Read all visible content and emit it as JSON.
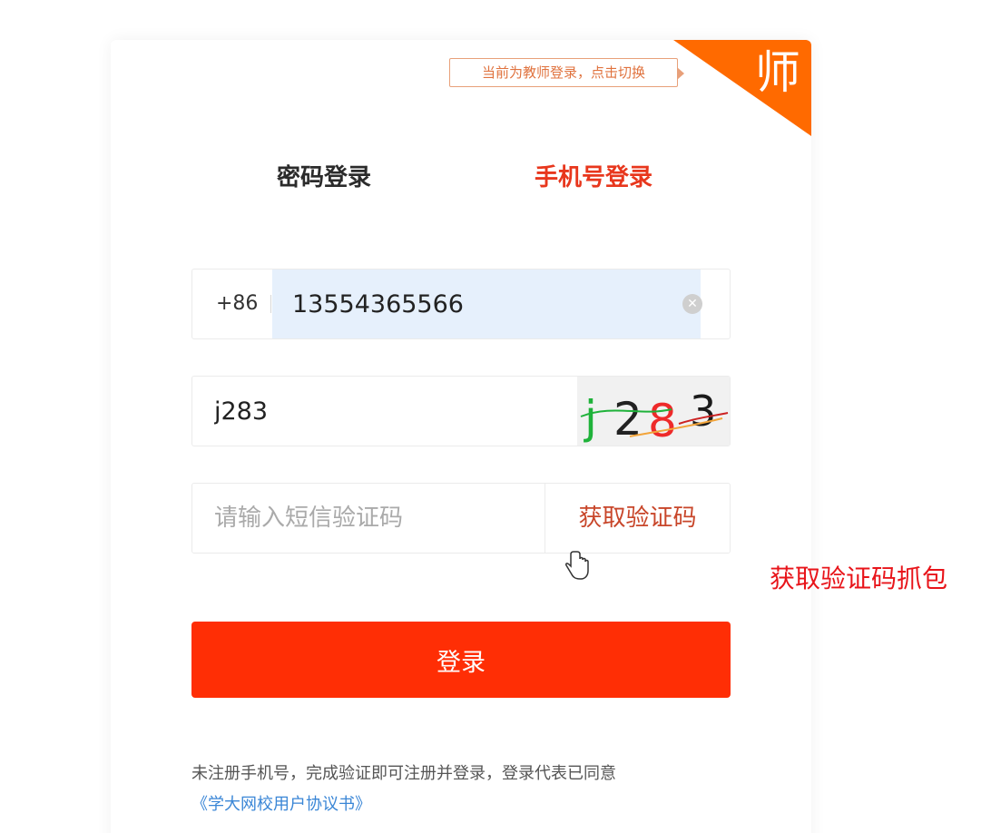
{
  "switch_tip": "当前为教师登录，点击切换",
  "corner_label": "师",
  "tabs": {
    "password": "密码登录",
    "phone": "手机号登录"
  },
  "phone_field": {
    "country_code": "+86",
    "value": "13554365566"
  },
  "captcha_field": {
    "value": "j283",
    "image_text": [
      "j",
      "2",
      "8",
      "3"
    ]
  },
  "sms_field": {
    "placeholder": "请输入短信验证码",
    "get_code_label": "获取验证码"
  },
  "login_button": "登录",
  "agreement": {
    "text": "未注册手机号，完成验证即可注册并登录，登录代表已同意",
    "link": "《学大网校用户协议书》"
  },
  "annotation": "获取验证码抓包",
  "colors": {
    "brand_orange": "#ff6a00",
    "login_red": "#ff2e05",
    "active_tab": "#e8371d",
    "link_blue": "#3a86d6",
    "annotation_red": "#e8141a"
  }
}
